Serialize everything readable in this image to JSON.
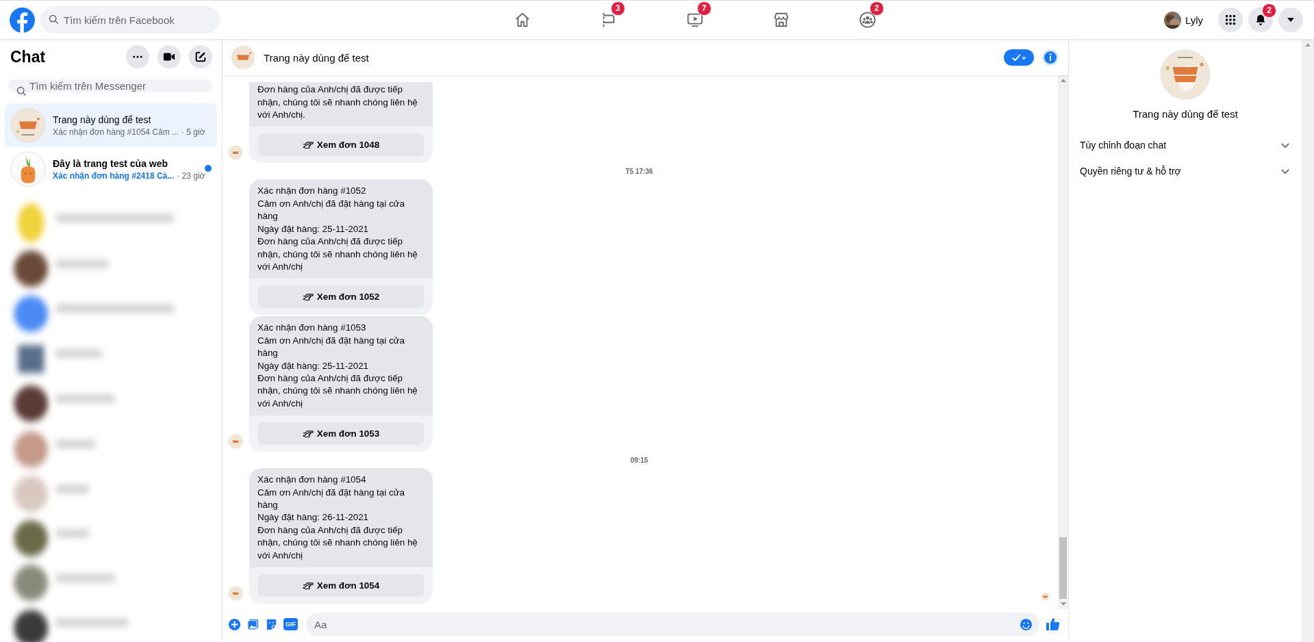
{
  "topbar": {
    "search_placeholder": "Tìm kiếm trên Facebook",
    "nav": [
      {
        "kind": "home"
      },
      {
        "kind": "flag",
        "badge": "3"
      },
      {
        "kind": "video",
        "badge": "7"
      },
      {
        "kind": "store"
      },
      {
        "kind": "groups",
        "badge": "2"
      }
    ],
    "user": "Lyly",
    "notifications_badge": "2"
  },
  "sidebar": {
    "title": "Chat",
    "search_placeholder": "Tìm kiếm trên Messenger",
    "conversations": [
      {
        "name": "Trang này dùng để test",
        "preview": "Xác nhận đơn hàng #1054 Cảm ...",
        "time": "· 5 giờ",
        "selected": true,
        "unread": false
      },
      {
        "name": "Đây là trang test của web",
        "preview": "Xác nhận đơn hàng #2418 Cả...",
        "time": "· 23 giờ",
        "selected": false,
        "unread": true
      }
    ]
  },
  "chat": {
    "title": "Trang này dùng để test",
    "messages": [
      {
        "kind": "card",
        "avatar": true,
        "lines": [
          "Đơn hàng của Anh/chị đã được tiếp nhận, chúng tôi sẽ nhanh chóng liên hệ với Anh/chị."
        ],
        "button": "Xem đơn 1048"
      },
      {
        "kind": "time",
        "text": "T5 17:36"
      },
      {
        "kind": "card",
        "avatar": false,
        "lines": [
          "Xác nhận đơn hàng #1052",
          "Cảm ơn Anh/chị đã đặt hàng tại cửa hàng",
          "Ngày đặt hàng: 25-11-2021",
          "Đơn hàng của Anh/chị đã được tiếp nhận, chúng tôi sẽ nhanh chóng liên hệ với Anh/chị"
        ],
        "button": "Xem đơn 1052"
      },
      {
        "kind": "card",
        "avatar": true,
        "lines": [
          "Xác nhận đơn hàng #1053",
          "Cảm ơn Anh/chị đã đặt hàng tại cửa hàng",
          "Ngày đặt hàng: 25-11-2021",
          "Đơn hàng của Anh/chị đã được tiếp nhận, chúng tôi sẽ nhanh chóng liên hệ với Anh/chị"
        ],
        "button": "Xem đơn 1053"
      },
      {
        "kind": "time",
        "text": "09:15"
      },
      {
        "kind": "card",
        "avatar": true,
        "lines": [
          "Xác nhận đơn hàng #1054",
          "Cảm ơn Anh/chị đã đặt hàng tại cửa hàng",
          "Ngày đặt hàng: 26-11-2021",
          "Đơn hàng của Anh/chị đã được tiếp nhận, chúng tôi sẽ nhanh chóng liên hệ với Anh/chị"
        ],
        "button": "Xem đơn 1054"
      }
    ],
    "composer": {
      "gif_label": "GIF",
      "placeholder": "Aa"
    }
  },
  "info_panel": {
    "name": "Trang này dùng để test",
    "sections": [
      {
        "label": "Tùy chỉnh đoạn chat",
        "expanded": false
      },
      {
        "label": "Quyền riêng tư & hỗ trợ",
        "expanded": false
      }
    ]
  }
}
